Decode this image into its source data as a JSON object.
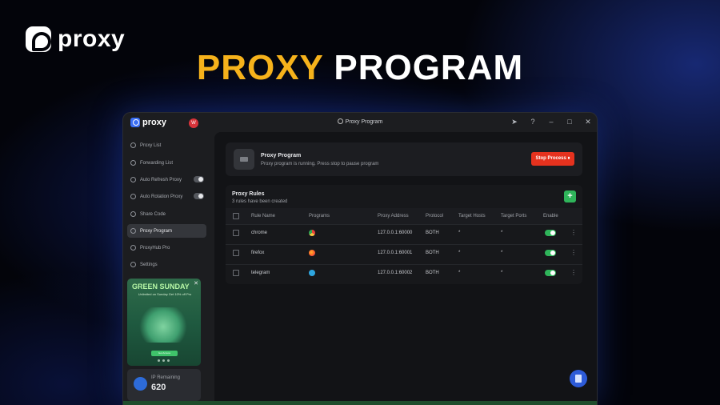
{
  "brand": {
    "name": "proxy"
  },
  "headline": {
    "part1": "PROXY",
    "part2": "PROGRAM"
  },
  "window": {
    "logo_text": "proxy",
    "avatar_letter": "W",
    "title": "Proxy Program",
    "controls": [
      "telegram-icon",
      "help-icon",
      "minimize-icon",
      "maximize-icon",
      "close-icon"
    ]
  },
  "sidebar": {
    "items": [
      {
        "label": "Proxy List",
        "icon": "list-icon"
      },
      {
        "label": "Forwarding List",
        "icon": "forward-icon"
      },
      {
        "label": "Auto Refresh Proxy",
        "icon": "refresh-icon",
        "toggle": true
      },
      {
        "label": "Auto Rotation Proxy",
        "icon": "rotation-icon",
        "toggle": true
      },
      {
        "label": "Share Code",
        "icon": "share-icon"
      },
      {
        "label": "Proxy Program",
        "icon": "program-icon",
        "active": true
      },
      {
        "label": "ProxyHub Pro",
        "icon": "hub-icon"
      },
      {
        "label": "Settings",
        "icon": "settings-icon"
      }
    ],
    "promo": {
      "title": "GREEN SUNDAY",
      "subtitle": "Unlimited on Sunday Get 10% off Pro",
      "button": "Get Access"
    },
    "ip": {
      "label": "IP Remaining",
      "value": "620"
    }
  },
  "status": {
    "title": "Proxy Program",
    "subtitle": "Proxy program is running. Press stop to pause program",
    "button": "Stop Process ⏸"
  },
  "rules": {
    "title": "Proxy Rules",
    "subtitle": "3 rules have been created",
    "add_label": "+",
    "columns": [
      "Rule Name",
      "Programs",
      "Proxy Address",
      "Protocol",
      "Target Hosts",
      "Target Ports",
      "Enable"
    ],
    "rows": [
      {
        "name": "chrome",
        "program_icon": "chrome-icon",
        "address": "127.0.0.1:60000",
        "protocol": "BOTH",
        "hosts": "*",
        "ports": "*",
        "enabled": true
      },
      {
        "name": "firefox",
        "program_icon": "firefox-icon",
        "address": "127.0.0.1:60001",
        "protocol": "BOTH",
        "hosts": "*",
        "ports": "*",
        "enabled": true
      },
      {
        "name": "telegram",
        "program_icon": "telegram-icon",
        "address": "127.0.0.1:60002",
        "protocol": "BOTH",
        "hosts": "*",
        "ports": "*",
        "enabled": true
      }
    ]
  },
  "colors": {
    "accent": "#f6b21b",
    "primary": "#3b6ff5",
    "danger": "#e5321e",
    "success": "#2fb45a"
  }
}
